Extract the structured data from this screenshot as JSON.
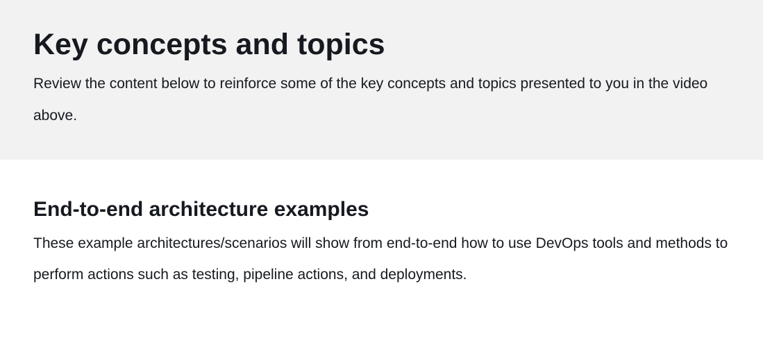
{
  "header": {
    "title": "Key concepts and topics",
    "description": "Review the content below to reinforce some of the key concepts and topics presented to you in the video above."
  },
  "section": {
    "title": "End-to-end architecture examples",
    "description": "These example architectures/scenarios will show from end-to-end how to use DevOps tools and methods to perform actions such as testing, pipeline actions, and deployments."
  }
}
